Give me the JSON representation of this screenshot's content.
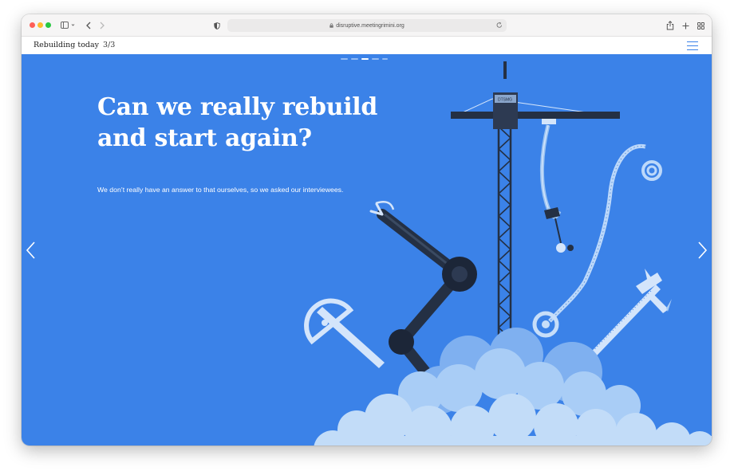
{
  "browser": {
    "url": "disruptive.meetingrimini.org"
  },
  "header": {
    "title": "Rebuilding today",
    "count": "3/3"
  },
  "slide": {
    "headline_line1": "Can we really rebuild",
    "headline_line2": "and start again?",
    "subtitle": "We don’t really have an answer to that ourselves, so we asked our interviewees.",
    "crane_sign": "DTSMG",
    "dots": [
      "slide-1",
      "slide-2",
      "slide-3",
      "slide-4",
      "slide-5"
    ],
    "active_dot": 2
  },
  "colors": {
    "slide_background": "#3b82e8",
    "accent": "#3b82e8",
    "navy": "#243044",
    "cloud": "#a9cdf6"
  },
  "icons": {
    "prev": "chevron-left-icon",
    "next": "chevron-right-icon",
    "menu": "hamburger-menu-icon"
  }
}
